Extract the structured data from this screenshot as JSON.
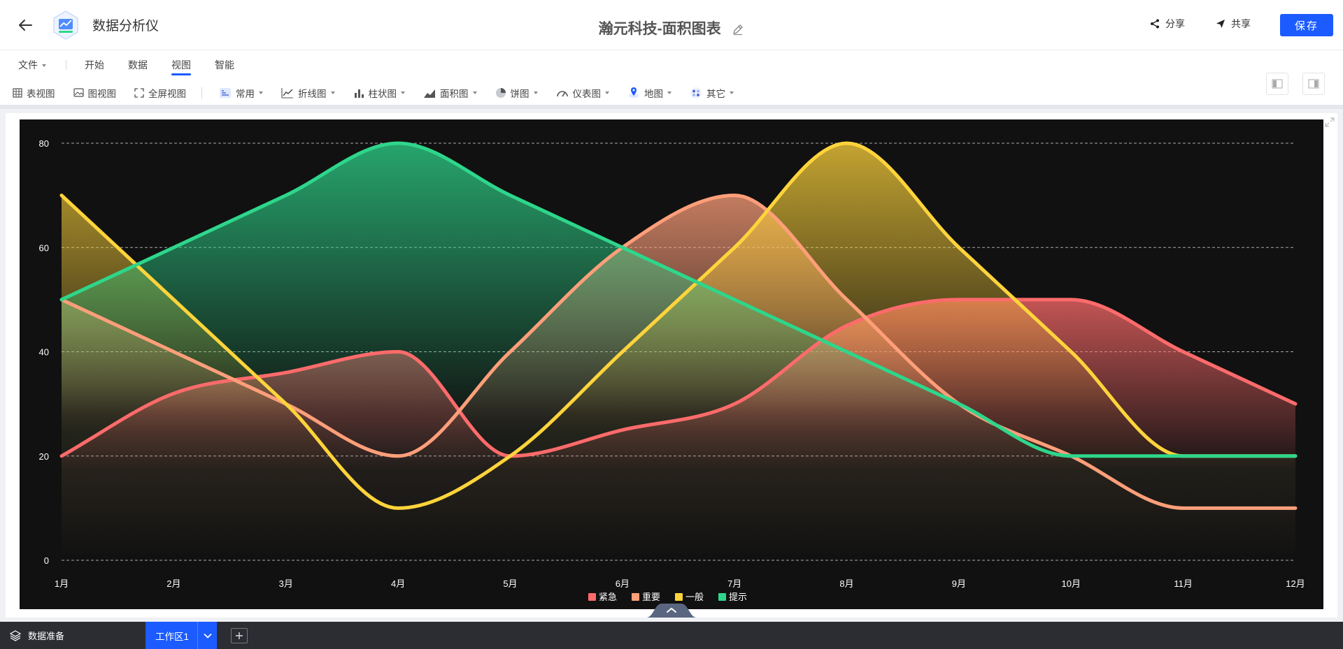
{
  "header": {
    "app_name": "数据分析仪",
    "doc_title": "瀚元科技-面积图表",
    "share_label": "分享",
    "cowork_label": "共享",
    "save_label": "保存"
  },
  "menu": {
    "file_label": "文件",
    "tabs": [
      "开始",
      "数据",
      "视图",
      "智能"
    ],
    "active_tab": "视图"
  },
  "toolbar": {
    "table_view": "表视图",
    "chart_view": "图视图",
    "fullscreen_view": "全屏视图",
    "common": "常用",
    "line_chart": "折线图",
    "bar_chart": "柱状图",
    "area_chart": "面积图",
    "pie_chart": "饼图",
    "gauge_chart": "仪表图",
    "map_chart": "地图",
    "other": "其它"
  },
  "footer": {
    "data_prep": "数据准备",
    "workspace_tab": "工作区1"
  },
  "chart_data": {
    "type": "area",
    "categories": [
      "1月",
      "2月",
      "3月",
      "4月",
      "5月",
      "6月",
      "7月",
      "8月",
      "9月",
      "10月",
      "11月",
      "12月"
    ],
    "ylim": [
      0,
      80
    ],
    "yticks": [
      0,
      20,
      40,
      60,
      80
    ],
    "grid": true,
    "legend_position": "bottom-center",
    "series": [
      {
        "name": "紧急",
        "color": "#ff6b6b",
        "values": [
          20,
          32,
          36,
          40,
          20,
          25,
          30,
          45,
          50,
          50,
          40,
          30
        ]
      },
      {
        "name": "重要",
        "color": "#ff9f7a",
        "values": [
          50,
          40,
          30,
          20,
          40,
          60,
          70,
          50,
          30,
          20,
          10,
          10
        ]
      },
      {
        "name": "一般",
        "color": "#ffd43b",
        "values": [
          70,
          50,
          30,
          10,
          20,
          40,
          60,
          80,
          60,
          40,
          20,
          20
        ]
      },
      {
        "name": "提示",
        "color": "#2ed68b",
        "values": [
          50,
          60,
          70,
          80,
          70,
          60,
          50,
          40,
          30,
          20,
          20,
          20
        ]
      }
    ]
  }
}
